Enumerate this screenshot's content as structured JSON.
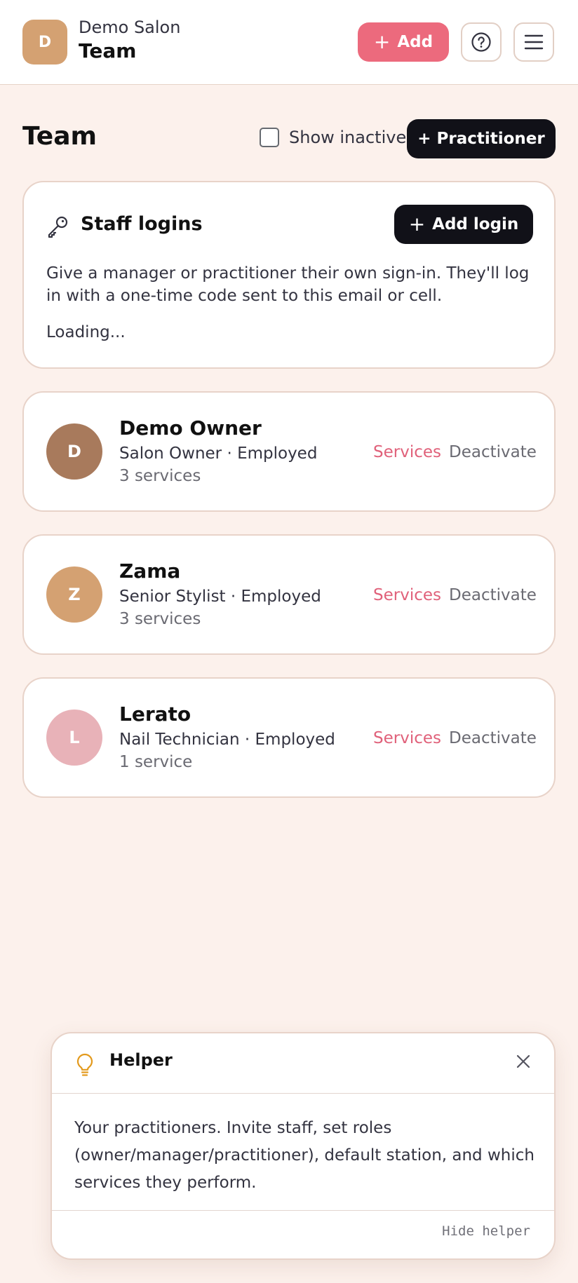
{
  "header": {
    "avatar_letter": "D",
    "salon_name": "Demo Salon",
    "page_name": "Team",
    "add_label": "Add",
    "help_icon": "question-circle-icon",
    "menu_icon": "hamburger-menu-icon"
  },
  "section": {
    "title": "Team",
    "show_inactive_label": "Show inactive",
    "show_inactive_checked": false,
    "add_practitioner_label": "+ Practitioner"
  },
  "staff_logins": {
    "title": "Staff logins",
    "icon": "key-icon",
    "add_login_label": "Add login",
    "description": "Give a manager or practitioner their own sign-in. They'll log in with a one-time code sent to this email or cell.",
    "status": "Loading..."
  },
  "staff": [
    {
      "initial": "D",
      "name": "Demo Owner",
      "role": "Salon Owner · Employed",
      "services_count": "3 services",
      "avatar_color": "#a87a5c",
      "services_link": "Services",
      "deactivate_link": "Deactivate"
    },
    {
      "initial": "Z",
      "name": "Zama",
      "role": "Senior Stylist · Employed",
      "services_count": "3 services",
      "avatar_color": "#d4a172",
      "services_link": "Services",
      "deactivate_link": "Deactivate"
    },
    {
      "initial": "L",
      "name": "Lerato",
      "role": "Nail Technician · Employed",
      "services_count": "1 service",
      "avatar_color": "#e8b2b8",
      "services_link": "Services",
      "deactivate_link": "Deactivate"
    }
  ],
  "helper": {
    "icon": "lightbulb-icon",
    "title": "Helper",
    "body": "Your practitioners. Invite staff, set roles (owner/manager/practitioner), default station, and which services they perform.",
    "hide_label": "Hide helper"
  },
  "colors": {
    "accent": "#ec6a7d",
    "background": "#fcf1ec",
    "dark_button": "#111118",
    "link_pink": "#e0617a"
  }
}
